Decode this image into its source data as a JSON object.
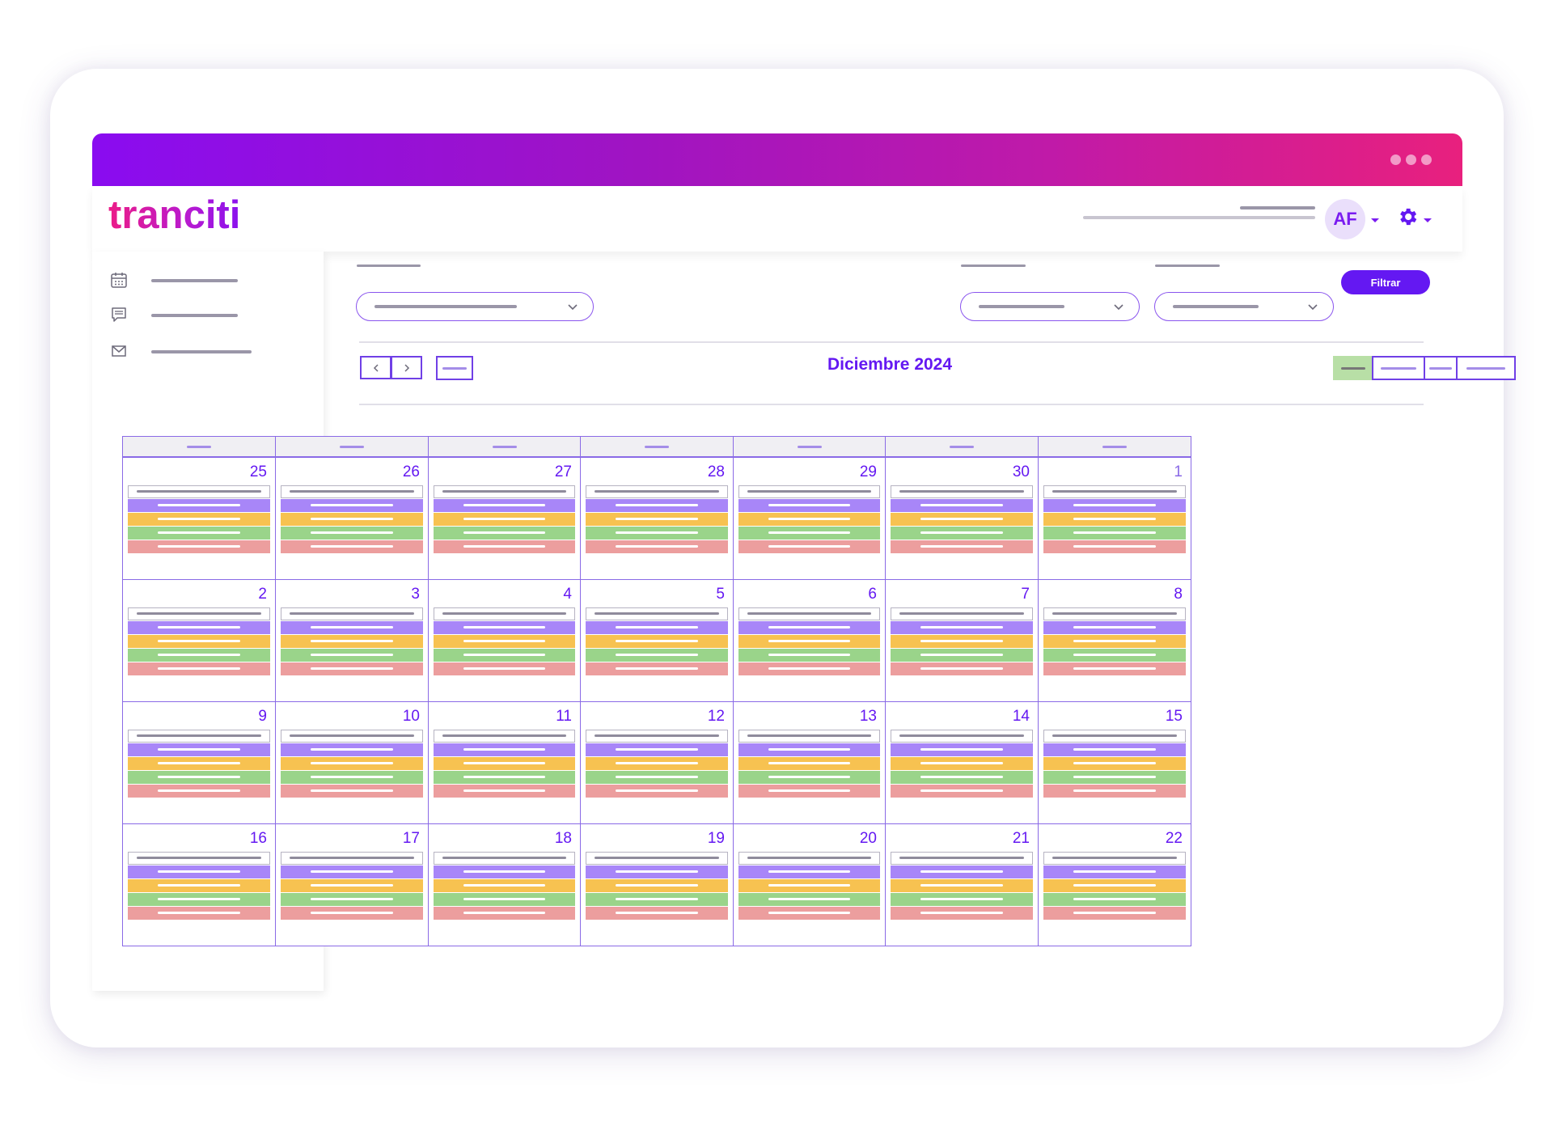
{
  "app": {
    "logo": "tranciti"
  },
  "header": {
    "user_initials": "AF"
  },
  "toolbar": {
    "filter_button": "Filtrar",
    "month_title": "Diciembre 2024"
  },
  "calendar": {
    "weeks": [
      [
        "25",
        "26",
        "27",
        "28",
        "29",
        "30",
        "1"
      ],
      [
        "2",
        "3",
        "4",
        "5",
        "6",
        "7",
        "8"
      ],
      [
        "9",
        "10",
        "11",
        "12",
        "13",
        "14",
        "15"
      ],
      [
        "16",
        "17",
        "18",
        "19",
        "20",
        "21",
        "22"
      ]
    ],
    "previous_month_days": [
      "25",
      "26",
      "27",
      "28",
      "29",
      "30"
    ]
  },
  "colors": {
    "accent": "#6418f2",
    "event_purple": "#a886f8",
    "event_yellow": "#f7c251",
    "event_green": "#9ad48a",
    "event_red": "#ec9e9e",
    "active_view": "#b8dfa6"
  },
  "icons": [
    "calendar-icon",
    "chat-icon",
    "mail-icon",
    "gear-icon",
    "chevron-left-icon",
    "chevron-right-icon",
    "chevron-down-icon"
  ]
}
